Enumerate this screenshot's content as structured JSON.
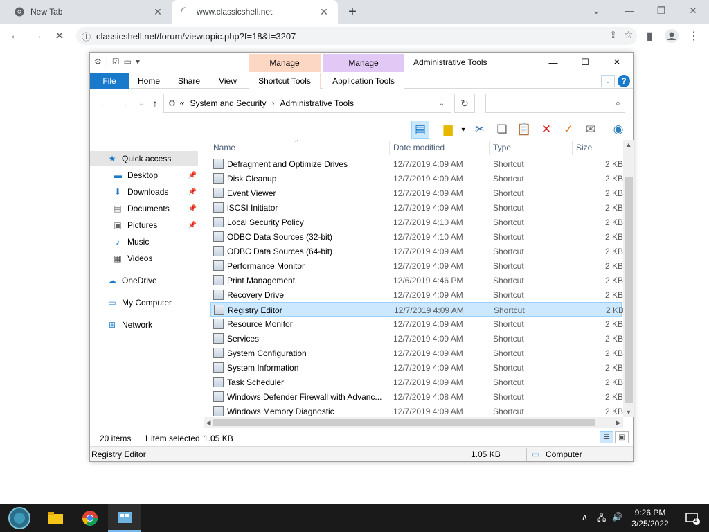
{
  "browser": {
    "tabs": [
      {
        "title": "New Tab"
      },
      {
        "title": "www.classicshell.net"
      }
    ],
    "url": "classicshell.net/forum/viewtopic.php?f=18&t=3207"
  },
  "explorer": {
    "window_title": "Administrative Tools",
    "context_tabs": [
      {
        "label": "Manage"
      },
      {
        "label": "Manage"
      }
    ],
    "ribbon_tabs": [
      {
        "label": "File"
      },
      {
        "label": "Home"
      },
      {
        "label": "Share"
      },
      {
        "label": "View"
      },
      {
        "label": "Shortcut Tools"
      },
      {
        "label": "Application Tools"
      }
    ],
    "breadcrumb": {
      "prefix": "«",
      "items": [
        "System and Security",
        "Administrative Tools"
      ]
    },
    "search_placeholder": "",
    "nav": [
      {
        "label": "Quick access"
      },
      {
        "label": "Desktop"
      },
      {
        "label": "Downloads"
      },
      {
        "label": "Documents"
      },
      {
        "label": "Pictures"
      },
      {
        "label": "Music"
      },
      {
        "label": "Videos"
      },
      {
        "label": "OneDrive"
      },
      {
        "label": "My Computer"
      },
      {
        "label": "Network"
      }
    ],
    "columns": [
      "Name",
      "Date modified",
      "Type",
      "Size"
    ],
    "files": [
      {
        "name": "Defragment and Optimize Drives",
        "date": "12/7/2019 4:09 AM",
        "type": "Shortcut",
        "size": "2 KB"
      },
      {
        "name": "Disk Cleanup",
        "date": "12/7/2019 4:09 AM",
        "type": "Shortcut",
        "size": "2 KB"
      },
      {
        "name": "Event Viewer",
        "date": "12/7/2019 4:09 AM",
        "type": "Shortcut",
        "size": "2 KB"
      },
      {
        "name": "iSCSI Initiator",
        "date": "12/7/2019 4:09 AM",
        "type": "Shortcut",
        "size": "2 KB"
      },
      {
        "name": "Local Security Policy",
        "date": "12/7/2019 4:10 AM",
        "type": "Shortcut",
        "size": "2 KB"
      },
      {
        "name": "ODBC Data Sources (32-bit)",
        "date": "12/7/2019 4:10 AM",
        "type": "Shortcut",
        "size": "2 KB"
      },
      {
        "name": "ODBC Data Sources (64-bit)",
        "date": "12/7/2019 4:09 AM",
        "type": "Shortcut",
        "size": "2 KB"
      },
      {
        "name": "Performance Monitor",
        "date": "12/7/2019 4:09 AM",
        "type": "Shortcut",
        "size": "2 KB"
      },
      {
        "name": "Print Management",
        "date": "12/6/2019 4:46 PM",
        "type": "Shortcut",
        "size": "2 KB"
      },
      {
        "name": "Recovery Drive",
        "date": "12/7/2019 4:09 AM",
        "type": "Shortcut",
        "size": "2 KB"
      },
      {
        "name": "Registry Editor",
        "date": "12/7/2019 4:09 AM",
        "type": "Shortcut",
        "size": "2 KB"
      },
      {
        "name": "Resource Monitor",
        "date": "12/7/2019 4:09 AM",
        "type": "Shortcut",
        "size": "2 KB"
      },
      {
        "name": "Services",
        "date": "12/7/2019 4:09 AM",
        "type": "Shortcut",
        "size": "2 KB"
      },
      {
        "name": "System Configuration",
        "date": "12/7/2019 4:09 AM",
        "type": "Shortcut",
        "size": "2 KB"
      },
      {
        "name": "System Information",
        "date": "12/7/2019 4:09 AM",
        "type": "Shortcut",
        "size": "2 KB"
      },
      {
        "name": "Task Scheduler",
        "date": "12/7/2019 4:09 AM",
        "type": "Shortcut",
        "size": "2 KB"
      },
      {
        "name": "Windows Defender Firewall with Advanc...",
        "date": "12/7/2019 4:08 AM",
        "type": "Shortcut",
        "size": "2 KB"
      },
      {
        "name": "Windows Memory Diagnostic",
        "date": "12/7/2019 4:09 AM",
        "type": "Shortcut",
        "size": "2 KB"
      }
    ],
    "selected_file": "Registry Editor",
    "status": {
      "items": "20 items",
      "selected": "1 item selected",
      "selected_size": "1.05 KB"
    },
    "status_bar": {
      "name": "Registry Editor",
      "size": "1.05 KB",
      "location": "Computer"
    }
  },
  "taskbar": {
    "time": "9:26 PM",
    "date": "3/25/2022",
    "notification_count": "1"
  },
  "colors": {
    "file_tab": "#1979ca",
    "manage_shortcut": "#fcd7c4",
    "manage_app": "#e2c8f4",
    "selection": "#cce8ff"
  }
}
